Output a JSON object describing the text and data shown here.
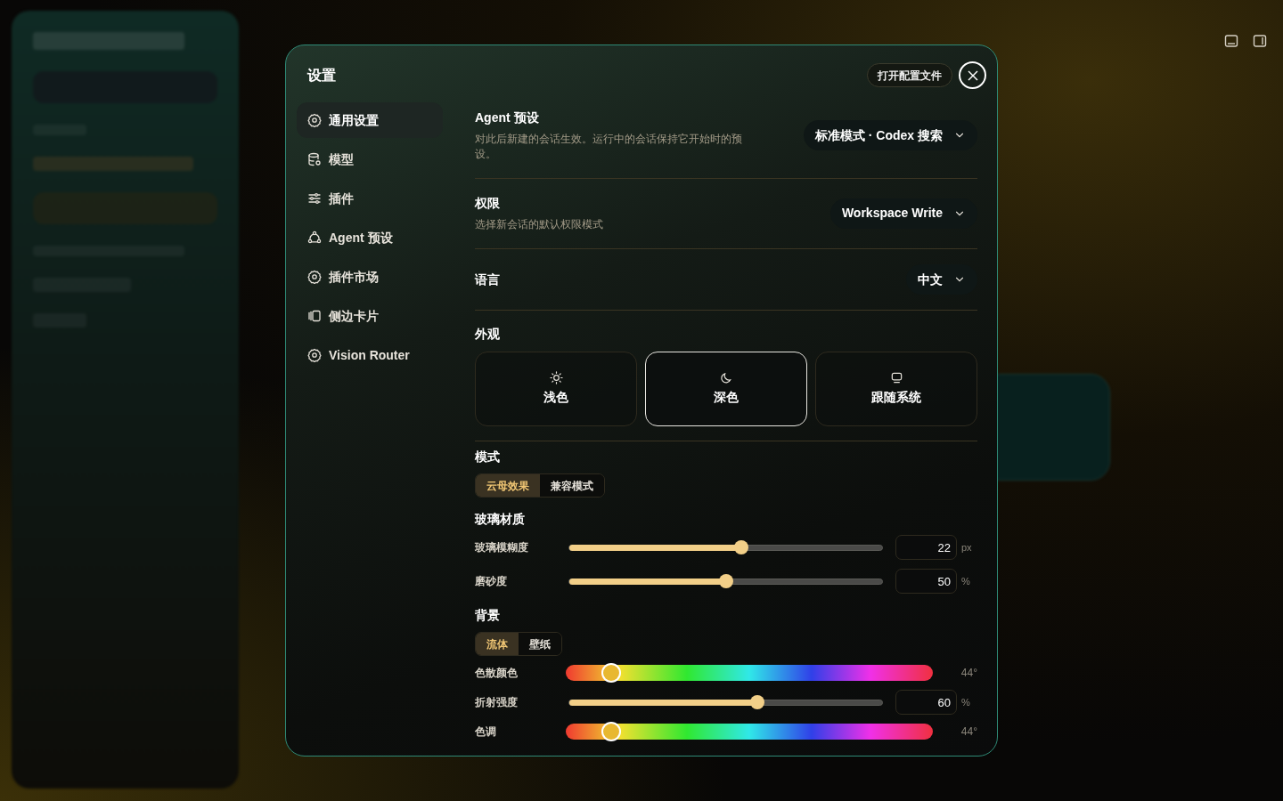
{
  "title": "设置",
  "open_config_button": "打开配置文件",
  "nav": [
    {
      "label": "通用设置",
      "selected": true
    },
    {
      "label": "模型",
      "selected": false
    },
    {
      "label": "插件",
      "selected": false
    },
    {
      "label": "Agent 预设",
      "selected": false
    },
    {
      "label": "插件市场",
      "selected": false
    },
    {
      "label": "侧边卡片",
      "selected": false
    },
    {
      "label": "Vision Router",
      "selected": false
    }
  ],
  "rows": [
    {
      "title": "Agent 预设",
      "description": "对此后新建的会话生效。运行中的会话保持它开始时的预设。",
      "value": "标准模式 · Codex 搜索"
    },
    {
      "title": "权限",
      "description": "选择新会话的默认权限模式",
      "value": "Workspace Write"
    },
    {
      "title": "语言",
      "value": "中文"
    }
  ],
  "appearance": {
    "title": "外观",
    "options": [
      {
        "label": "浅色",
        "selected": false
      },
      {
        "label": "深色",
        "selected": true
      },
      {
        "label": "跟随系统",
        "selected": false
      }
    ]
  },
  "mode": {
    "title": "模式",
    "options": [
      {
        "label": "云母效果",
        "selected": true
      },
      {
        "label": "兼容模式",
        "selected": false
      }
    ]
  },
  "glass": {
    "title": "玻璃材质",
    "controls": [
      {
        "kind": "slider",
        "label": "玻璃模糊度",
        "level": 0.55,
        "value": "22",
        "unit": "px"
      },
      {
        "kind": "slider",
        "label": "磨砂度",
        "level": 0.5,
        "value": "50",
        "unit": "%"
      }
    ]
  },
  "background": {
    "title": "背景",
    "options": [
      {
        "label": "流体",
        "selected": true
      },
      {
        "label": "壁纸",
        "selected": false
      }
    ],
    "controls": [
      {
        "kind": "hue",
        "label": "色散颜色",
        "level": 0.124,
        "reading": "44°"
      },
      {
        "kind": "slider",
        "label": "折射强度",
        "level": 0.6,
        "value": "60",
        "unit": "%"
      },
      {
        "kind": "hue",
        "label": "色调",
        "level": 0.124,
        "reading": "44°"
      }
    ]
  }
}
